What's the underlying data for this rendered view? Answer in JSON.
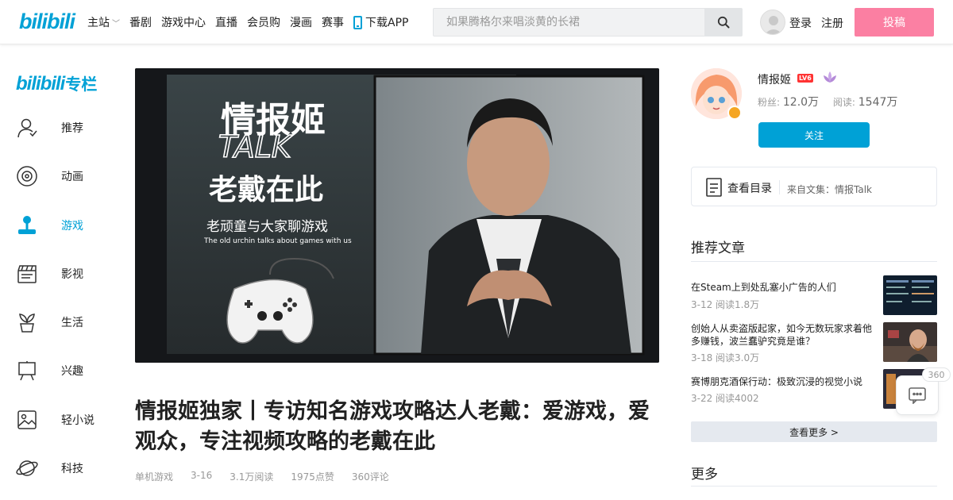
{
  "header": {
    "logo": "bilibili",
    "nav": [
      {
        "label": "主站",
        "has_caret": true
      },
      {
        "label": "番剧"
      },
      {
        "label": "游戏中心"
      },
      {
        "label": "直播"
      },
      {
        "label": "会员购"
      },
      {
        "label": "漫画"
      },
      {
        "label": "赛事"
      },
      {
        "label": "下载APP",
        "icon": "phone-icon"
      }
    ],
    "search_placeholder": "如果腾格尔来唱淡黄的长裙",
    "login": "登录",
    "register": "注册",
    "post": "投稿"
  },
  "sidebar": {
    "logo_main": "bilibili",
    "logo_suffix": "专栏",
    "items": [
      {
        "label": "推荐",
        "icon": "recommend-icon",
        "active": false
      },
      {
        "label": "动画",
        "icon": "disc-icon",
        "active": false
      },
      {
        "label": "游戏",
        "icon": "joystick-icon",
        "active": true
      },
      {
        "label": "影视",
        "icon": "clapperboard-icon",
        "active": false
      },
      {
        "label": "生活",
        "icon": "plant-icon",
        "active": false
      },
      {
        "label": "兴趣",
        "icon": "easel-icon",
        "active": false
      },
      {
        "label": "轻小说",
        "icon": "picture-icon",
        "active": false
      },
      {
        "label": "科技",
        "icon": "planet-icon",
        "active": false
      }
    ]
  },
  "banner": {
    "title_line1": "情报姬",
    "title_line2": "TALK",
    "headline": "老戴在此",
    "subtitle": "老顽童与大家聊游戏",
    "subtitle_en": "The old urchin talks about games with us"
  },
  "article": {
    "title": "情报姬独家丨专访知名游戏攻略达人老戴：爱游戏，爱观众，专注视频攻略的老戴在此",
    "category": "单机游戏",
    "date": "3-16",
    "reads": "3.1万阅读",
    "likes": "1975点赞",
    "comments": "360评论"
  },
  "author": {
    "name": "情报姬",
    "level": "LV6",
    "fans_label": "粉丝:",
    "fans": "12.0万",
    "reads_label": "阅读:",
    "reads": "1547万",
    "follow": "关注"
  },
  "catalog": {
    "label": "查看目录",
    "source": "来自文集：情报Talk"
  },
  "recommend": {
    "title": "推荐文章",
    "items": [
      {
        "title": "在Steam上到处乱塞小广告的人们",
        "meta": "3-12 阅读1.8万"
      },
      {
        "title": "创始人从卖盗版起家，如今无数玩家求着他多赚钱，波兰蠢驴究竟是谁？",
        "meta": "3-18 阅读3.0万"
      },
      {
        "title": "赛博朋克酒保行动：极致沉浸的视觉小说",
        "meta": "3-22 阅读4002"
      }
    ],
    "more": "查看更多 >"
  },
  "more_section": {
    "title": "更多"
  },
  "floating": {
    "count": "360"
  },
  "colors": {
    "brand": "#00a1d6",
    "pink": "#fb7299"
  }
}
